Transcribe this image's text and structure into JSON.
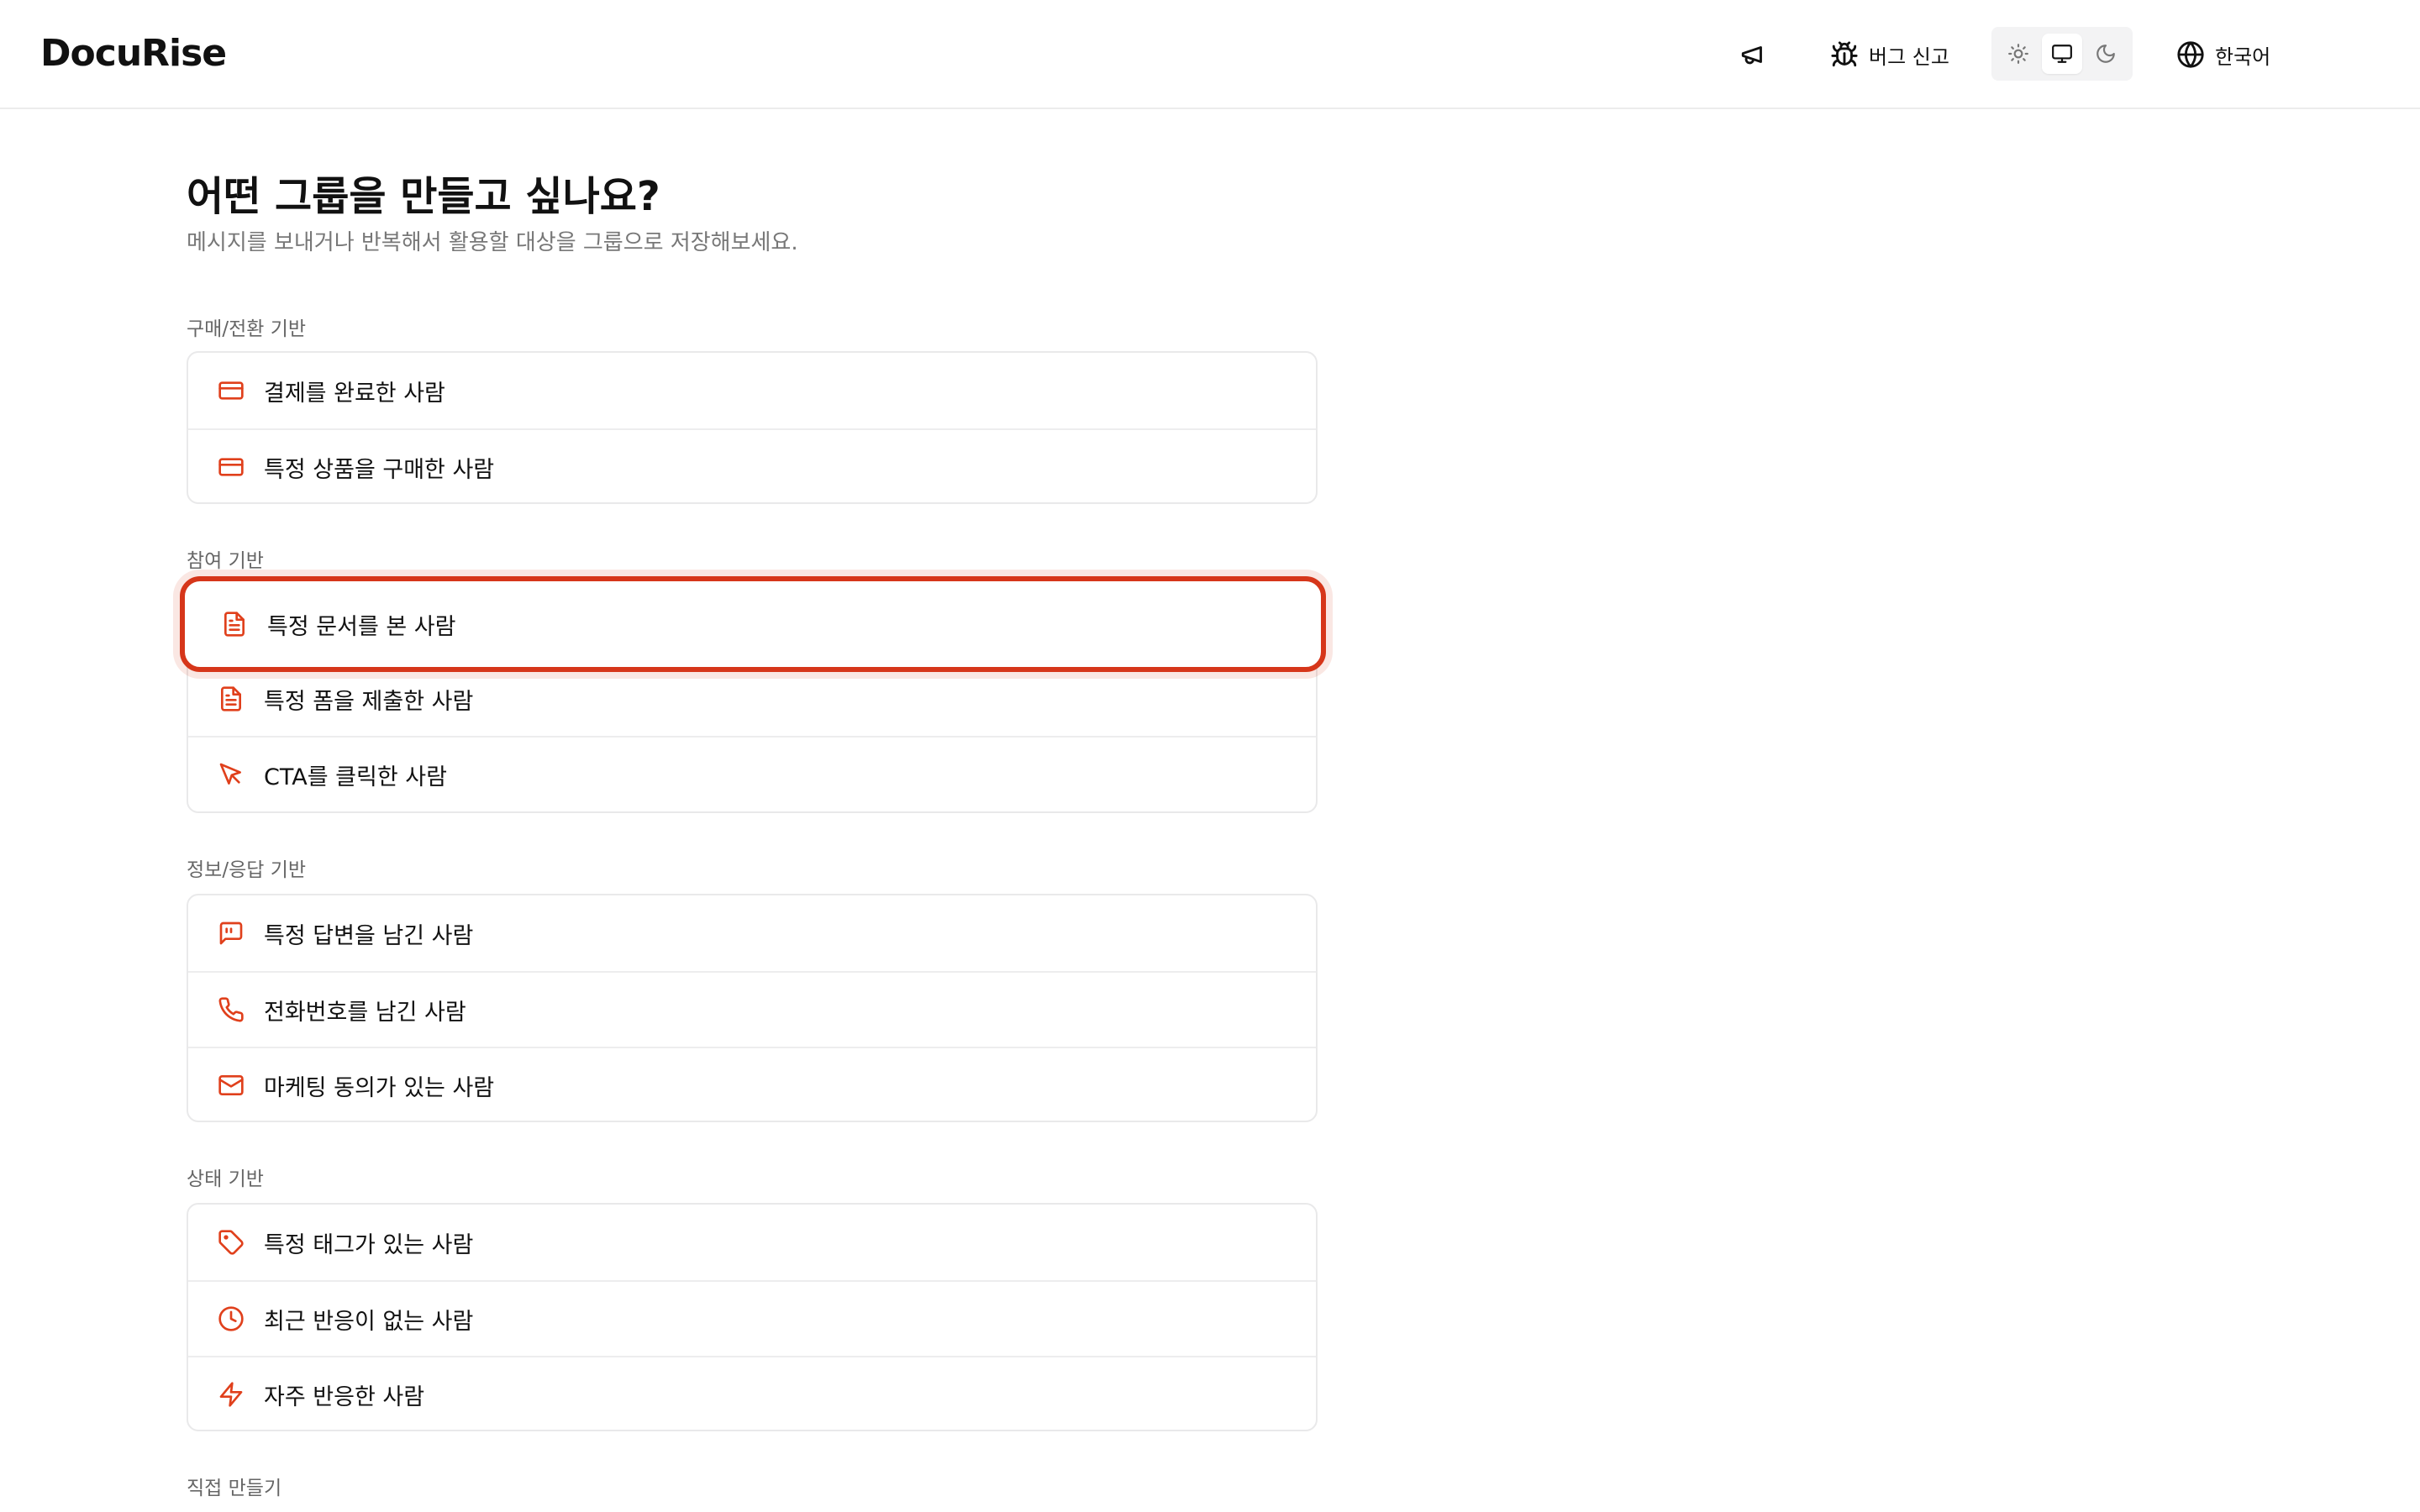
{
  "header": {
    "logo": "DocuRise",
    "bug_report_label": "버그 신고",
    "language_label": "한국어"
  },
  "page": {
    "title": "어떤 그룹을 만들고 싶나요?",
    "subtitle": "메시지를 보내거나 반복해서 활용할 대상을 그룹으로 저장해보세요."
  },
  "sections": {
    "purchase": {
      "label": "구매/전환 기반",
      "items": [
        "결제를 완료한 사람",
        "특정 상품을 구매한 사람"
      ]
    },
    "engagement": {
      "label": "참여 기반",
      "items": [
        "특정 문서를 본 사람",
        "특정 폼을 제출한 사람",
        "CTA를 클릭한 사람"
      ]
    },
    "info": {
      "label": "정보/응답 기반",
      "items": [
        "특정 답변을 남긴 사람",
        "전화번호를 남긴 사람",
        "마케팅 동의가 있는 사람"
      ]
    },
    "status": {
      "label": "상태 기반",
      "items": [
        "특정 태그가 있는 사람",
        "최근 반응이 없는 사람",
        "자주 반응한 사람"
      ]
    },
    "custom": {
      "label": "직접 만들기"
    }
  },
  "theme": {
    "selected": "system"
  },
  "colors": {
    "accent": "#e0401c",
    "highlight": "#d6361a"
  }
}
